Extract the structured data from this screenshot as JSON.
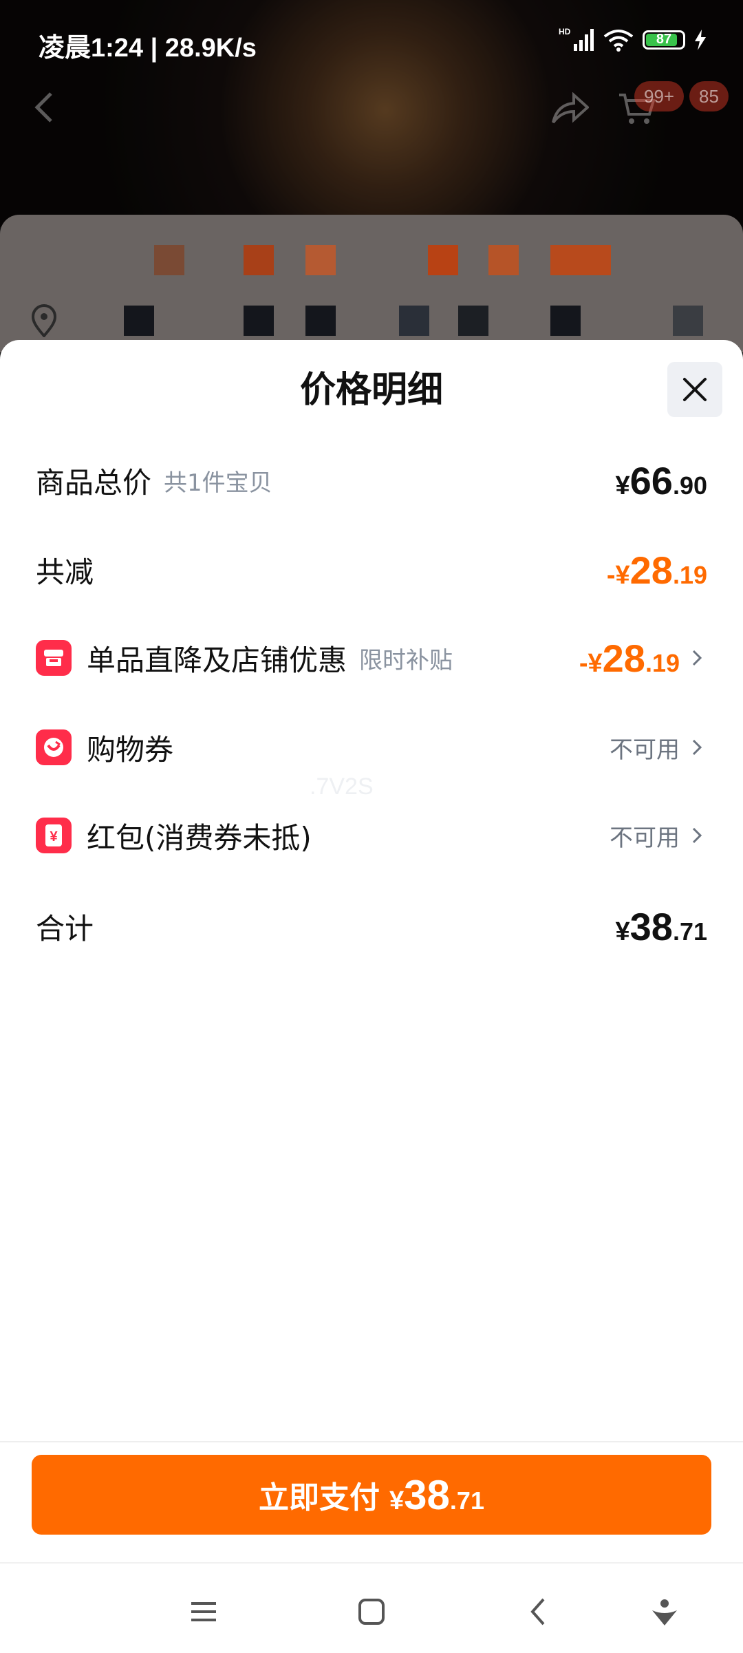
{
  "status_bar": {
    "time": "凌晨1:24 | 28.9K/s",
    "battery": "87"
  },
  "background_page": {
    "cart_badge": "99+",
    "count_badge": "85"
  },
  "sheet": {
    "title": "价格明细",
    "rows": [
      {
        "label": "商品总价",
        "sub": "共1件宝贝",
        "amount": {
          "cur": "¥",
          "int": "66",
          "dec": ".90"
        }
      },
      {
        "label": "共减",
        "amount": {
          "cur": "-¥",
          "int": "28",
          "dec": ".19"
        }
      },
      {
        "label": "单品直降及店铺优惠",
        "sub": "限时补贴",
        "icon": "store-icon",
        "amount": {
          "cur": "-¥",
          "int": "28",
          "dec": ".19"
        }
      },
      {
        "label": "购物券",
        "icon": "coupon-icon",
        "status": "不可用"
      },
      {
        "label": "红包(消费券未抵)",
        "icon": "red-packet-icon",
        "status": "不可用"
      },
      {
        "label": "合计",
        "amount": {
          "cur": "¥",
          "int": "38",
          "dec": ".71"
        }
      }
    ],
    "watermark": ".7V2S"
  },
  "pay_button": {
    "label": "立即支付",
    "amount": {
      "cur": "¥",
      "int": "38",
      "dec": ".71"
    }
  },
  "colors": {
    "accent": "#ff6a00",
    "icon_red": "#ff2d4a"
  }
}
